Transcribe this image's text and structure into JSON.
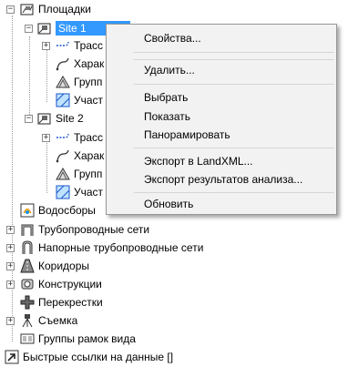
{
  "tree": {
    "root_label": "Площадки",
    "site1": {
      "label": "Site 1",
      "children": [
        "Трасс",
        "Харак",
        "Групп",
        "Участ"
      ]
    },
    "site2": {
      "label": "Site 2",
      "children": [
        "Трасс",
        "Харак",
        "Групп",
        "Участ"
      ]
    },
    "top_items": [
      "Водосборы",
      "Трубопроводные сети",
      "Напорные трубопроводные сети",
      "Коридоры",
      "Конструкции",
      "Перекрестки",
      "Съемка",
      "Группы рамок вида"
    ],
    "quick_links": "Быстрые ссылки на данные []"
  },
  "context_menu": {
    "items": [
      "Свойства...",
      "Удалить...",
      "Выбрать",
      "Показать",
      "Панорамировать",
      "Экспорт в LandXML...",
      "Экспорт результатов анализа...",
      "Обновить"
    ]
  },
  "colors": {
    "selection": "#3399ff",
    "menu_bg": "#f2f2f2",
    "menu_border": "#979797"
  }
}
